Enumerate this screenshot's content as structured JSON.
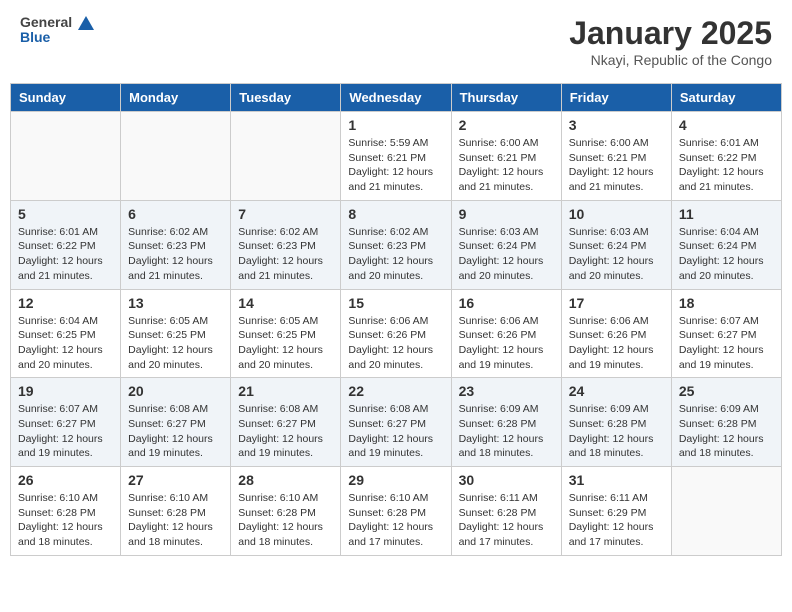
{
  "header": {
    "logo_general": "General",
    "logo_blue": "Blue",
    "month_title": "January 2025",
    "location": "Nkayi, Republic of the Congo"
  },
  "weekdays": [
    "Sunday",
    "Monday",
    "Tuesday",
    "Wednesday",
    "Thursday",
    "Friday",
    "Saturday"
  ],
  "weeks": [
    {
      "shade": false,
      "days": [
        {
          "number": "",
          "empty": true
        },
        {
          "number": "",
          "empty": true
        },
        {
          "number": "",
          "empty": true
        },
        {
          "number": "1",
          "sunrise": "Sunrise: 5:59 AM",
          "sunset": "Sunset: 6:21 PM",
          "daylight": "Daylight: 12 hours and 21 minutes."
        },
        {
          "number": "2",
          "sunrise": "Sunrise: 6:00 AM",
          "sunset": "Sunset: 6:21 PM",
          "daylight": "Daylight: 12 hours and 21 minutes."
        },
        {
          "number": "3",
          "sunrise": "Sunrise: 6:00 AM",
          "sunset": "Sunset: 6:21 PM",
          "daylight": "Daylight: 12 hours and 21 minutes."
        },
        {
          "number": "4",
          "sunrise": "Sunrise: 6:01 AM",
          "sunset": "Sunset: 6:22 PM",
          "daylight": "Daylight: 12 hours and 21 minutes."
        }
      ]
    },
    {
      "shade": true,
      "days": [
        {
          "number": "5",
          "sunrise": "Sunrise: 6:01 AM",
          "sunset": "Sunset: 6:22 PM",
          "daylight": "Daylight: 12 hours and 21 minutes."
        },
        {
          "number": "6",
          "sunrise": "Sunrise: 6:02 AM",
          "sunset": "Sunset: 6:23 PM",
          "daylight": "Daylight: 12 hours and 21 minutes."
        },
        {
          "number": "7",
          "sunrise": "Sunrise: 6:02 AM",
          "sunset": "Sunset: 6:23 PM",
          "daylight": "Daylight: 12 hours and 21 minutes."
        },
        {
          "number": "8",
          "sunrise": "Sunrise: 6:02 AM",
          "sunset": "Sunset: 6:23 PM",
          "daylight": "Daylight: 12 hours and 20 minutes."
        },
        {
          "number": "9",
          "sunrise": "Sunrise: 6:03 AM",
          "sunset": "Sunset: 6:24 PM",
          "daylight": "Daylight: 12 hours and 20 minutes."
        },
        {
          "number": "10",
          "sunrise": "Sunrise: 6:03 AM",
          "sunset": "Sunset: 6:24 PM",
          "daylight": "Daylight: 12 hours and 20 minutes."
        },
        {
          "number": "11",
          "sunrise": "Sunrise: 6:04 AM",
          "sunset": "Sunset: 6:24 PM",
          "daylight": "Daylight: 12 hours and 20 minutes."
        }
      ]
    },
    {
      "shade": false,
      "days": [
        {
          "number": "12",
          "sunrise": "Sunrise: 6:04 AM",
          "sunset": "Sunset: 6:25 PM",
          "daylight": "Daylight: 12 hours and 20 minutes."
        },
        {
          "number": "13",
          "sunrise": "Sunrise: 6:05 AM",
          "sunset": "Sunset: 6:25 PM",
          "daylight": "Daylight: 12 hours and 20 minutes."
        },
        {
          "number": "14",
          "sunrise": "Sunrise: 6:05 AM",
          "sunset": "Sunset: 6:25 PM",
          "daylight": "Daylight: 12 hours and 20 minutes."
        },
        {
          "number": "15",
          "sunrise": "Sunrise: 6:06 AM",
          "sunset": "Sunset: 6:26 PM",
          "daylight": "Daylight: 12 hours and 20 minutes."
        },
        {
          "number": "16",
          "sunrise": "Sunrise: 6:06 AM",
          "sunset": "Sunset: 6:26 PM",
          "daylight": "Daylight: 12 hours and 19 minutes."
        },
        {
          "number": "17",
          "sunrise": "Sunrise: 6:06 AM",
          "sunset": "Sunset: 6:26 PM",
          "daylight": "Daylight: 12 hours and 19 minutes."
        },
        {
          "number": "18",
          "sunrise": "Sunrise: 6:07 AM",
          "sunset": "Sunset: 6:27 PM",
          "daylight": "Daylight: 12 hours and 19 minutes."
        }
      ]
    },
    {
      "shade": true,
      "days": [
        {
          "number": "19",
          "sunrise": "Sunrise: 6:07 AM",
          "sunset": "Sunset: 6:27 PM",
          "daylight": "Daylight: 12 hours and 19 minutes."
        },
        {
          "number": "20",
          "sunrise": "Sunrise: 6:08 AM",
          "sunset": "Sunset: 6:27 PM",
          "daylight": "Daylight: 12 hours and 19 minutes."
        },
        {
          "number": "21",
          "sunrise": "Sunrise: 6:08 AM",
          "sunset": "Sunset: 6:27 PM",
          "daylight": "Daylight: 12 hours and 19 minutes."
        },
        {
          "number": "22",
          "sunrise": "Sunrise: 6:08 AM",
          "sunset": "Sunset: 6:27 PM",
          "daylight": "Daylight: 12 hours and 19 minutes."
        },
        {
          "number": "23",
          "sunrise": "Sunrise: 6:09 AM",
          "sunset": "Sunset: 6:28 PM",
          "daylight": "Daylight: 12 hours and 18 minutes."
        },
        {
          "number": "24",
          "sunrise": "Sunrise: 6:09 AM",
          "sunset": "Sunset: 6:28 PM",
          "daylight": "Daylight: 12 hours and 18 minutes."
        },
        {
          "number": "25",
          "sunrise": "Sunrise: 6:09 AM",
          "sunset": "Sunset: 6:28 PM",
          "daylight": "Daylight: 12 hours and 18 minutes."
        }
      ]
    },
    {
      "shade": false,
      "days": [
        {
          "number": "26",
          "sunrise": "Sunrise: 6:10 AM",
          "sunset": "Sunset: 6:28 PM",
          "daylight": "Daylight: 12 hours and 18 minutes."
        },
        {
          "number": "27",
          "sunrise": "Sunrise: 6:10 AM",
          "sunset": "Sunset: 6:28 PM",
          "daylight": "Daylight: 12 hours and 18 minutes."
        },
        {
          "number": "28",
          "sunrise": "Sunrise: 6:10 AM",
          "sunset": "Sunset: 6:28 PM",
          "daylight": "Daylight: 12 hours and 18 minutes."
        },
        {
          "number": "29",
          "sunrise": "Sunrise: 6:10 AM",
          "sunset": "Sunset: 6:28 PM",
          "daylight": "Daylight: 12 hours and 17 minutes."
        },
        {
          "number": "30",
          "sunrise": "Sunrise: 6:11 AM",
          "sunset": "Sunset: 6:28 PM",
          "daylight": "Daylight: 12 hours and 17 minutes."
        },
        {
          "number": "31",
          "sunrise": "Sunrise: 6:11 AM",
          "sunset": "Sunset: 6:29 PM",
          "daylight": "Daylight: 12 hours and 17 minutes."
        },
        {
          "number": "",
          "empty": true
        }
      ]
    }
  ]
}
